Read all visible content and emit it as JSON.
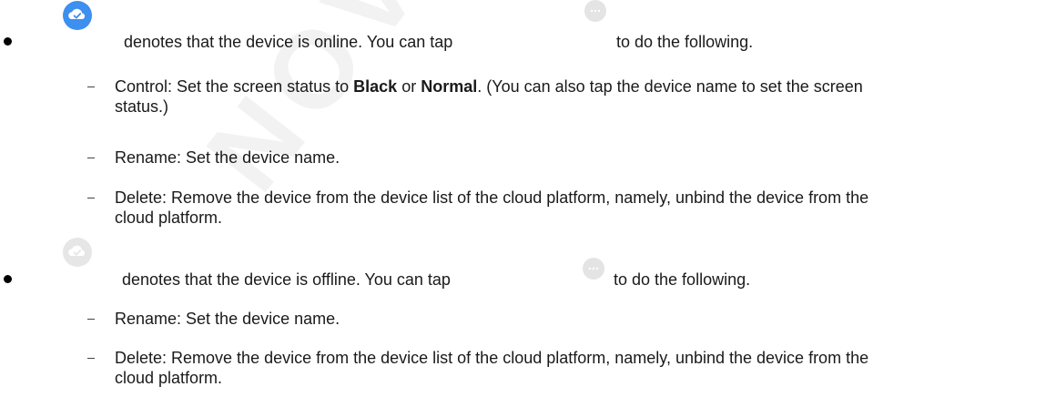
{
  "watermark": "NOVASTAR TECH",
  "online": {
    "status_icon": "cloud-online-icon",
    "more_icon": "more-dots-icon",
    "text_before_more": "denotes that the device is online. You can tap",
    "text_after_more": "to do the following.",
    "items": [
      {
        "prefix": "Control: Set the screen status to ",
        "bold1": "Black",
        "middle": " or ",
        "bold2": "Normal",
        "suffix": ". (You can also tap the device name to set the screen status.)"
      },
      {
        "text": "Rename: Set the device name."
      },
      {
        "text": "Delete: Remove the device from the device list of the cloud platform, namely, unbind the device from the cloud platform."
      }
    ]
  },
  "offline": {
    "status_icon": "cloud-offline-icon",
    "more_icon": "more-dots-icon",
    "text_before_more": "denotes that the device is offline. You can tap",
    "text_after_more": "to do the following.",
    "items": [
      {
        "text": "Rename: Set the device name."
      },
      {
        "text": "Delete: Remove the device from the device list of the cloud platform, namely, unbind the device from the cloud platform."
      }
    ]
  },
  "colors": {
    "online_icon": "#3d8ff0",
    "offline_icon": "#e6e6e6",
    "more_icon": "#e4e4e4"
  }
}
